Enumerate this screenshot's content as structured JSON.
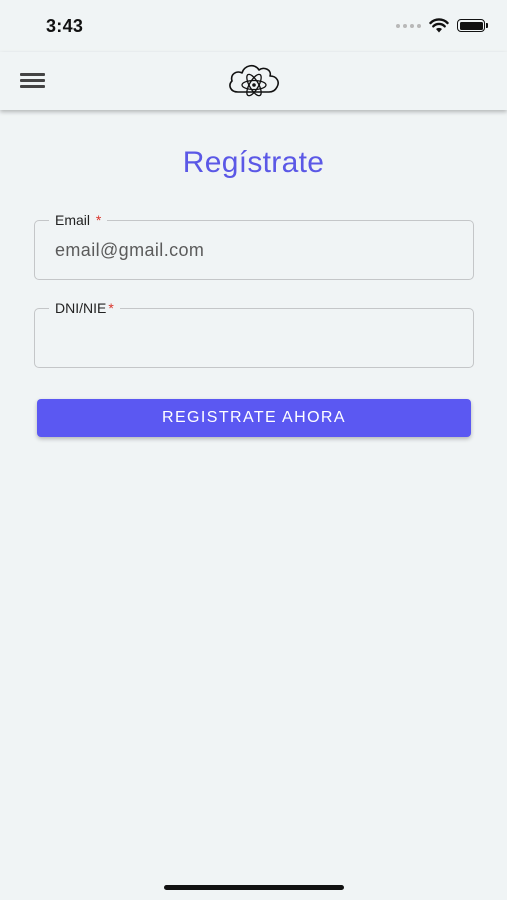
{
  "status_bar": {
    "time": "3:43",
    "icons": [
      "signal-dots-icon",
      "wifi-icon",
      "battery-icon"
    ]
  },
  "header": {
    "menu_icon": "hamburger-menu-icon",
    "logo_icon": "cloud-atom-logo"
  },
  "page": {
    "title": "Regístrate"
  },
  "form": {
    "email": {
      "label": "Email",
      "required_mark": "*",
      "value": "",
      "placeholder": "email@gmail.com"
    },
    "dni": {
      "label": "DNI/NIE",
      "required_mark": "*",
      "value": "",
      "placeholder": ""
    },
    "submit_label": "REGISTRATE AHORA"
  },
  "colors": {
    "accent": "#5b58f2",
    "title": "#5b58e6",
    "background": "#f0f4f5",
    "required": "#d9342b"
  }
}
